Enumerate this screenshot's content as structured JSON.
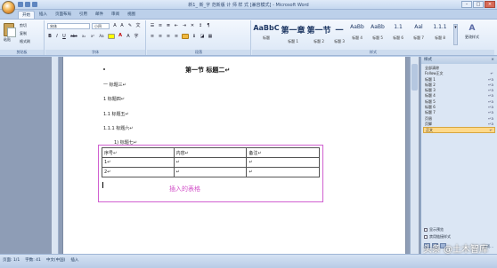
{
  "window": {
    "title": "新1_ 新_字 范新版 计 师 样 式 [兼容模式] - Microsoft Word",
    "controls": [
      "–",
      "□",
      "×"
    ]
  },
  "ribbon_tabs": [
    "开始",
    "插入",
    "页面布局",
    "引用",
    "邮件",
    "审阅",
    "视图"
  ],
  "clipboard": {
    "paste_label": "粘贴",
    "cut_label": "剪切",
    "copy_label": "复制",
    "format_painter_label": "格式刷",
    "group_label": "剪贴板"
  },
  "font_group": {
    "font_name": "宋体",
    "font_size": "小四",
    "group_label": "字体",
    "buttons": [
      "B",
      "I",
      "U",
      "abe",
      "x₂",
      "x²",
      "Aa",
      "A"
    ]
  },
  "paragraph_group": {
    "group_label": "段落"
  },
  "styles_group": {
    "group_label": "样式",
    "change_styles_label": "更改样式",
    "items": [
      {
        "preview": "AaBbC",
        "name": "标题"
      },
      {
        "preview": "第一章",
        "name": "标题 1"
      },
      {
        "preview": "第一节",
        "name": "标题 2"
      },
      {
        "preview": "一",
        "name": "标题 3"
      },
      {
        "preview": "AaBb",
        "name": "标题 4"
      },
      {
        "preview": "AaBb",
        "name": "标题 5"
      },
      {
        "preview": "1.1",
        "name": "标题 6"
      },
      {
        "preview": "Aal",
        "name": "标题 7"
      },
      {
        "preview": "1.1.1",
        "name": "标题 8"
      }
    ]
  },
  "document": {
    "heading": "第一节  标题二↵",
    "lines": [
      "一  标题三↵",
      "1 标题四↵",
      "1.1 标题五↵",
      "1.1.1 标题六↵",
      "1)  标题七↵"
    ],
    "table": {
      "rows": [
        [
          "序号↵",
          "内容↵",
          "备注↵"
        ],
        [
          "1↵",
          "↵",
          "↵"
        ],
        [
          "2↵",
          "↵",
          "↵"
        ]
      ]
    },
    "table_caption": "插入的表格"
  },
  "styles_pane": {
    "title": "样式",
    "close": "×",
    "items": [
      {
        "label": "全部清除",
        "mark": ""
      },
      {
        "label": "Follow正文",
        "mark": "↵"
      },
      {
        "label": "标题 1",
        "mark": "↵a"
      },
      {
        "label": "标题 2",
        "mark": "↵a"
      },
      {
        "label": "标题 3",
        "mark": "↵a"
      },
      {
        "label": "标题 4",
        "mark": "↵a"
      },
      {
        "label": "标题 5",
        "mark": "↵a"
      },
      {
        "label": "标题 6",
        "mark": "↵a"
      },
      {
        "label": "标题 7",
        "mark": "↵a"
      },
      {
        "label": "页眉",
        "mark": "↵a"
      },
      {
        "label": "页脚",
        "mark": "↵a"
      },
      {
        "label": "正文",
        "mark": "↵",
        "selected": true
      }
    ],
    "show_preview": "显示预览",
    "disable_linked": "禁用链接样式",
    "options": "选项..."
  },
  "status_bar": {
    "page": "页面: 1/1",
    "words": "字数: 41",
    "language": "中文(中国)",
    "mode": "插入"
  },
  "watermark": "头条 @土木智库",
  "colors": {
    "table_frame": "#d060d0",
    "caption": "#d24fc8",
    "selected_style": "#ffd98a"
  }
}
